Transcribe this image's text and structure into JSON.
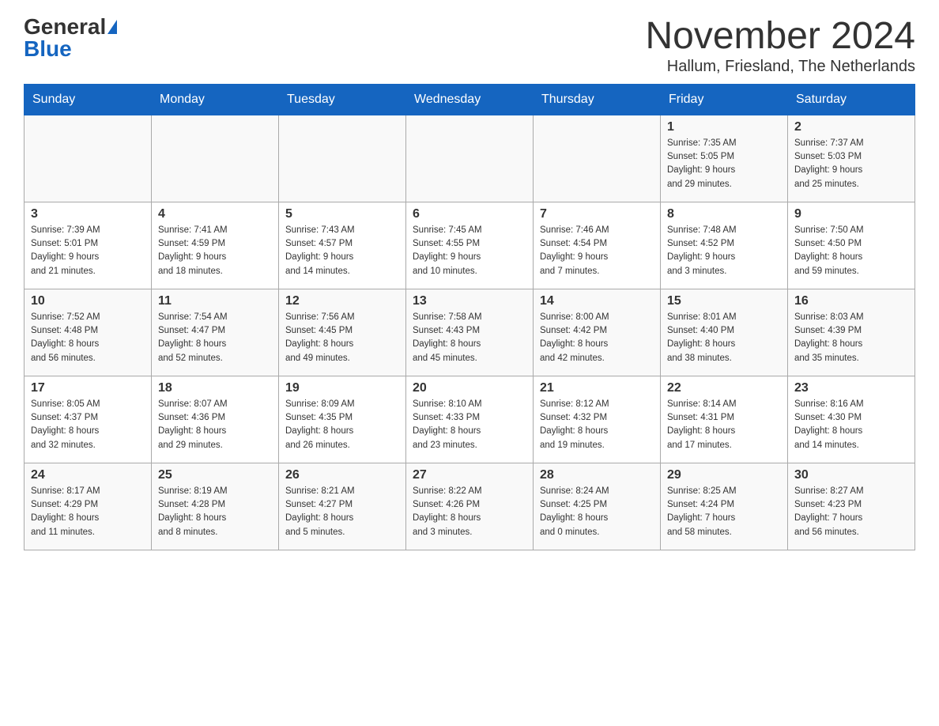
{
  "logo": {
    "general": "General",
    "blue": "Blue"
  },
  "title": {
    "month_year": "November 2024",
    "location": "Hallum, Friesland, The Netherlands"
  },
  "headers": [
    "Sunday",
    "Monday",
    "Tuesday",
    "Wednesday",
    "Thursday",
    "Friday",
    "Saturday"
  ],
  "weeks": [
    [
      {
        "day": "",
        "info": ""
      },
      {
        "day": "",
        "info": ""
      },
      {
        "day": "",
        "info": ""
      },
      {
        "day": "",
        "info": ""
      },
      {
        "day": "",
        "info": ""
      },
      {
        "day": "1",
        "info": "Sunrise: 7:35 AM\nSunset: 5:05 PM\nDaylight: 9 hours\nand 29 minutes."
      },
      {
        "day": "2",
        "info": "Sunrise: 7:37 AM\nSunset: 5:03 PM\nDaylight: 9 hours\nand 25 minutes."
      }
    ],
    [
      {
        "day": "3",
        "info": "Sunrise: 7:39 AM\nSunset: 5:01 PM\nDaylight: 9 hours\nand 21 minutes."
      },
      {
        "day": "4",
        "info": "Sunrise: 7:41 AM\nSunset: 4:59 PM\nDaylight: 9 hours\nand 18 minutes."
      },
      {
        "day": "5",
        "info": "Sunrise: 7:43 AM\nSunset: 4:57 PM\nDaylight: 9 hours\nand 14 minutes."
      },
      {
        "day": "6",
        "info": "Sunrise: 7:45 AM\nSunset: 4:55 PM\nDaylight: 9 hours\nand 10 minutes."
      },
      {
        "day": "7",
        "info": "Sunrise: 7:46 AM\nSunset: 4:54 PM\nDaylight: 9 hours\nand 7 minutes."
      },
      {
        "day": "8",
        "info": "Sunrise: 7:48 AM\nSunset: 4:52 PM\nDaylight: 9 hours\nand 3 minutes."
      },
      {
        "day": "9",
        "info": "Sunrise: 7:50 AM\nSunset: 4:50 PM\nDaylight: 8 hours\nand 59 minutes."
      }
    ],
    [
      {
        "day": "10",
        "info": "Sunrise: 7:52 AM\nSunset: 4:48 PM\nDaylight: 8 hours\nand 56 minutes."
      },
      {
        "day": "11",
        "info": "Sunrise: 7:54 AM\nSunset: 4:47 PM\nDaylight: 8 hours\nand 52 minutes."
      },
      {
        "day": "12",
        "info": "Sunrise: 7:56 AM\nSunset: 4:45 PM\nDaylight: 8 hours\nand 49 minutes."
      },
      {
        "day": "13",
        "info": "Sunrise: 7:58 AM\nSunset: 4:43 PM\nDaylight: 8 hours\nand 45 minutes."
      },
      {
        "day": "14",
        "info": "Sunrise: 8:00 AM\nSunset: 4:42 PM\nDaylight: 8 hours\nand 42 minutes."
      },
      {
        "day": "15",
        "info": "Sunrise: 8:01 AM\nSunset: 4:40 PM\nDaylight: 8 hours\nand 38 minutes."
      },
      {
        "day": "16",
        "info": "Sunrise: 8:03 AM\nSunset: 4:39 PM\nDaylight: 8 hours\nand 35 minutes."
      }
    ],
    [
      {
        "day": "17",
        "info": "Sunrise: 8:05 AM\nSunset: 4:37 PM\nDaylight: 8 hours\nand 32 minutes."
      },
      {
        "day": "18",
        "info": "Sunrise: 8:07 AM\nSunset: 4:36 PM\nDaylight: 8 hours\nand 29 minutes."
      },
      {
        "day": "19",
        "info": "Sunrise: 8:09 AM\nSunset: 4:35 PM\nDaylight: 8 hours\nand 26 minutes."
      },
      {
        "day": "20",
        "info": "Sunrise: 8:10 AM\nSunset: 4:33 PM\nDaylight: 8 hours\nand 23 minutes."
      },
      {
        "day": "21",
        "info": "Sunrise: 8:12 AM\nSunset: 4:32 PM\nDaylight: 8 hours\nand 19 minutes."
      },
      {
        "day": "22",
        "info": "Sunrise: 8:14 AM\nSunset: 4:31 PM\nDaylight: 8 hours\nand 17 minutes."
      },
      {
        "day": "23",
        "info": "Sunrise: 8:16 AM\nSunset: 4:30 PM\nDaylight: 8 hours\nand 14 minutes."
      }
    ],
    [
      {
        "day": "24",
        "info": "Sunrise: 8:17 AM\nSunset: 4:29 PM\nDaylight: 8 hours\nand 11 minutes."
      },
      {
        "day": "25",
        "info": "Sunrise: 8:19 AM\nSunset: 4:28 PM\nDaylight: 8 hours\nand 8 minutes."
      },
      {
        "day": "26",
        "info": "Sunrise: 8:21 AM\nSunset: 4:27 PM\nDaylight: 8 hours\nand 5 minutes."
      },
      {
        "day": "27",
        "info": "Sunrise: 8:22 AM\nSunset: 4:26 PM\nDaylight: 8 hours\nand 3 minutes."
      },
      {
        "day": "28",
        "info": "Sunrise: 8:24 AM\nSunset: 4:25 PM\nDaylight: 8 hours\nand 0 minutes."
      },
      {
        "day": "29",
        "info": "Sunrise: 8:25 AM\nSunset: 4:24 PM\nDaylight: 7 hours\nand 58 minutes."
      },
      {
        "day": "30",
        "info": "Sunrise: 8:27 AM\nSunset: 4:23 PM\nDaylight: 7 hours\nand 56 minutes."
      }
    ]
  ]
}
